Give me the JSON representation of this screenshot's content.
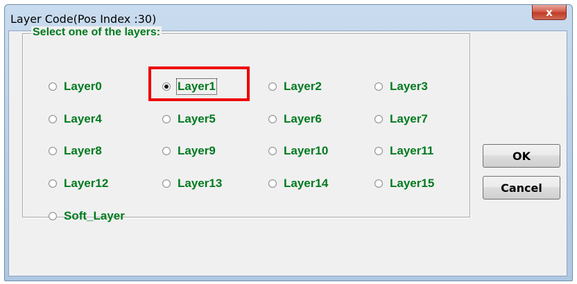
{
  "window": {
    "title": "Layer Code(Pos Index :30)",
    "close_glyph": "x"
  },
  "group": {
    "label": "Select one of the layers:"
  },
  "layers": [
    {
      "label": "Layer0",
      "checked": false
    },
    {
      "label": "Layer1",
      "checked": true,
      "focused": true,
      "highlighted": true
    },
    {
      "label": "Layer2",
      "checked": false
    },
    {
      "label": "Layer3",
      "checked": false
    },
    {
      "label": "Layer4",
      "checked": false
    },
    {
      "label": "Layer5",
      "checked": false
    },
    {
      "label": "Layer6",
      "checked": false
    },
    {
      "label": "Layer7",
      "checked": false
    },
    {
      "label": "Layer8",
      "checked": false
    },
    {
      "label": "Layer9",
      "checked": false
    },
    {
      "label": "Layer10",
      "checked": false
    },
    {
      "label": "Layer11",
      "checked": false
    },
    {
      "label": "Layer12",
      "checked": false
    },
    {
      "label": "Layer13",
      "checked": false
    },
    {
      "label": "Layer14",
      "checked": false
    },
    {
      "label": "Layer15",
      "checked": false
    },
    {
      "label": "Soft_Layer",
      "checked": false
    }
  ],
  "buttons": {
    "ok_label": "OK",
    "cancel_label": "Cancel"
  },
  "colors": {
    "label_text": "#007a1f",
    "highlight": "#ef0000",
    "close_button": "#c03c28"
  }
}
